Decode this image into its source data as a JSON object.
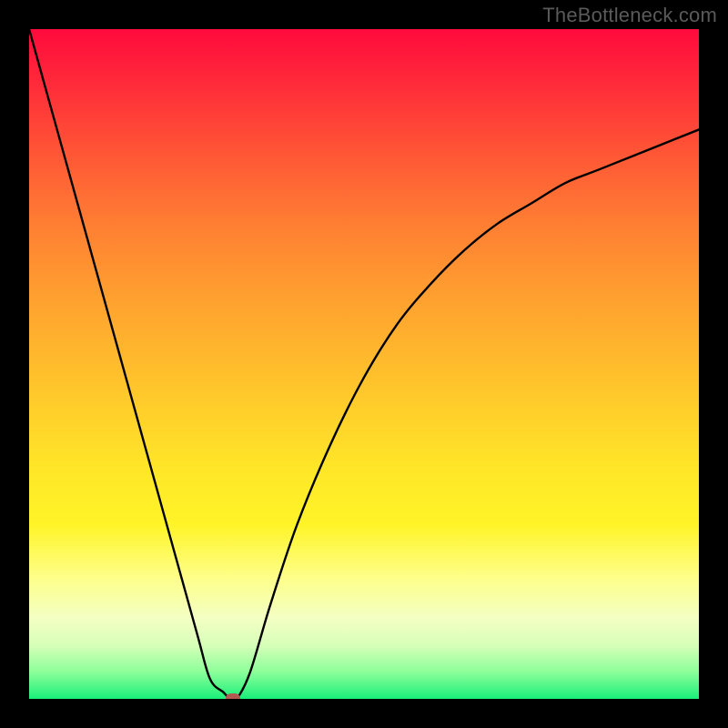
{
  "watermark": "TheBottleneck.com",
  "chart_data": {
    "type": "line",
    "title": "",
    "xlabel": "",
    "ylabel": "",
    "xlim": [
      0,
      100
    ],
    "ylim": [
      0,
      100
    ],
    "grid": false,
    "legend": false,
    "series": [
      {
        "name": "bottleneck-curve",
        "x": [
          0,
          5,
          10,
          15,
          20,
          25,
          27,
          29,
          30,
          31,
          33,
          36,
          40,
          45,
          50,
          55,
          60,
          65,
          70,
          75,
          80,
          85,
          90,
          95,
          100
        ],
        "values": [
          100,
          82,
          64,
          46,
          28,
          10,
          3,
          1,
          0,
          0,
          4,
          14,
          26,
          38,
          48,
          56,
          62,
          67,
          71,
          74,
          77,
          79,
          81,
          83,
          85
        ]
      }
    ],
    "marker": {
      "x": 30.5,
      "y": 0,
      "label": "optimal-point"
    },
    "background_gradient": {
      "type": "vertical",
      "stops": [
        {
          "pos": 0.0,
          "color": "#ff0a3c"
        },
        {
          "pos": 0.5,
          "color": "#ffd22a"
        },
        {
          "pos": 0.82,
          "color": "#fdff8a"
        },
        {
          "pos": 1.0,
          "color": "#19ef7a"
        }
      ]
    }
  }
}
